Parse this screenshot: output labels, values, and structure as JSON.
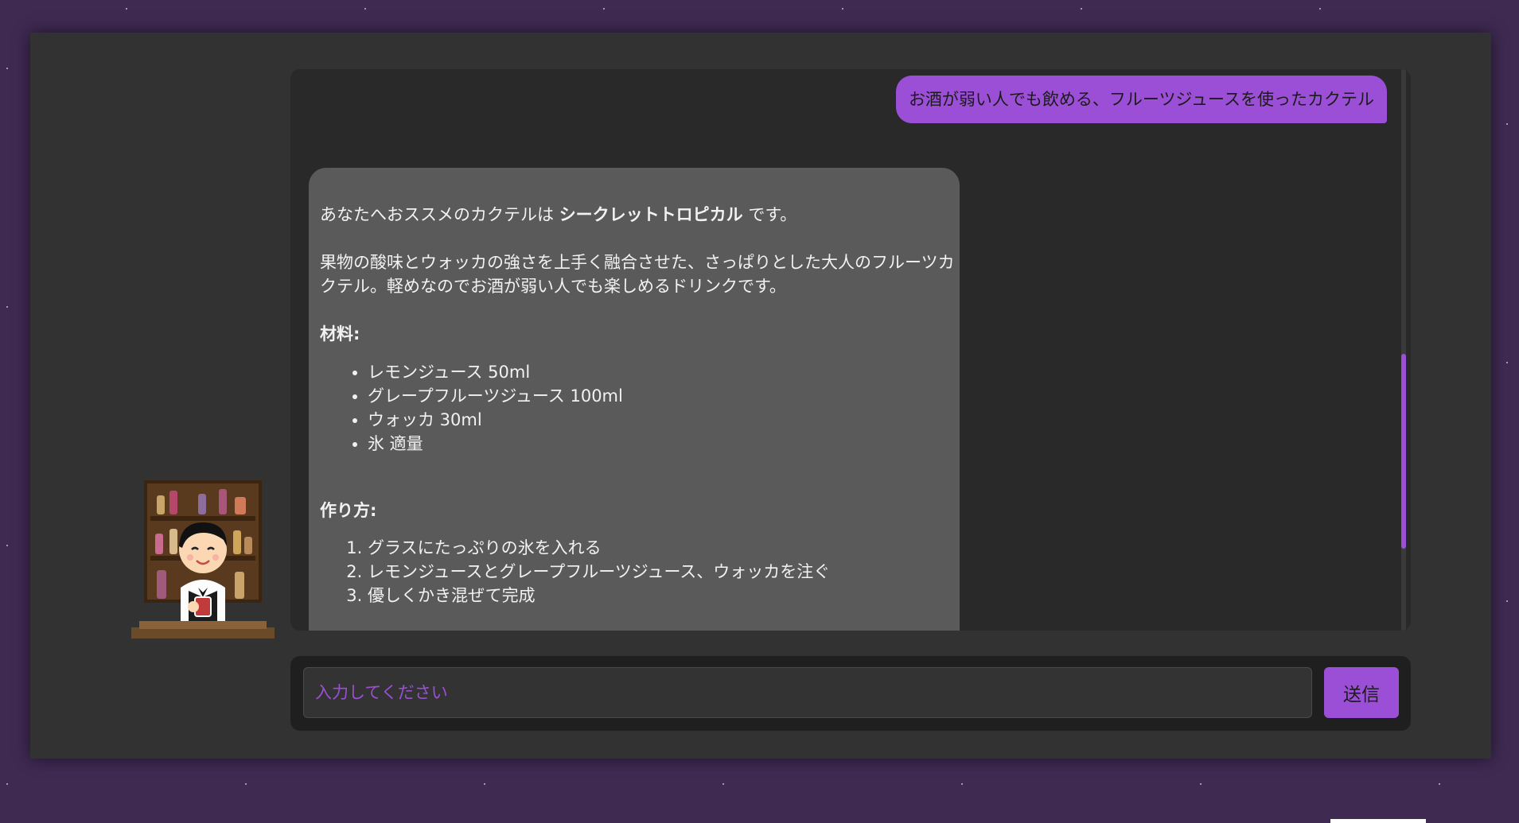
{
  "colors": {
    "background": "#3f2a52",
    "window": "#323232",
    "chat_panel": "#292929",
    "bot_bubble": "#5a5a5a",
    "accent": "#9b4fd6"
  },
  "chat": {
    "user_message": "お酒が弱い人でも飲める、フルーツジュースを使ったカクテル",
    "bot": {
      "intro_prefix": "あなたへおススメのカクテルは ",
      "cocktail_name": "シークレットトロピカル",
      "intro_suffix": " です。",
      "description": "果物の酸味とウォッカの強さを上手く融合させた、さっぱりとした大人のフルーツカクテル。軽めなのでお酒が弱い人でも楽しめるドリンクです。",
      "ingredients_heading": "材料:",
      "ingredients": [
        "レモンジュース 50ml",
        "グレープフルーツジュース 100ml",
        "ウォッカ 30ml",
        "氷 適量"
      ],
      "method_heading": "作り方:",
      "method": [
        "グラスにたっぷりの氷を入れる",
        "レモンジュースとグレープフルーツジュース、ウォッカを注ぐ",
        "優しくかき混ぜて完成"
      ]
    }
  },
  "input": {
    "placeholder": "入力してください",
    "value": ""
  },
  "send_label": "送信",
  "avatar_icon": "bartender-icon"
}
